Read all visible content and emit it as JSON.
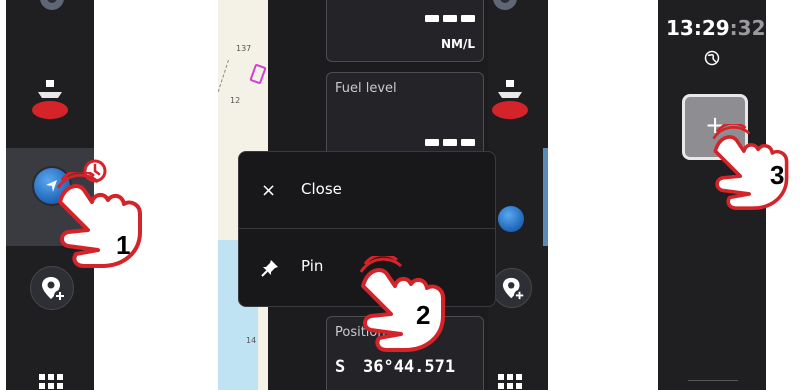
{
  "step1": {
    "label": "1"
  },
  "step2": {
    "label": "2",
    "cards": {
      "top_unit": "NM/L",
      "fuel_title": "Fuel level",
      "position_title": "Position",
      "lat_hem": "S",
      "lat_value": "36°44.571"
    },
    "map_depths": [
      "137",
      "12",
      "14"
    ],
    "menu": {
      "close_label": "Close",
      "close_icon": "×",
      "pin_label": "Pin"
    }
  },
  "step3": {
    "label": "3",
    "time_main": "13:29",
    "time_sec": ":32",
    "add_icon": "+"
  },
  "colors": {
    "panel": "#1f1f22",
    "hand_fill": "#ffffff",
    "hand_stroke": "#d5232a",
    "accent_blue": "#1d64b8",
    "boat_red": "#d5232a"
  }
}
